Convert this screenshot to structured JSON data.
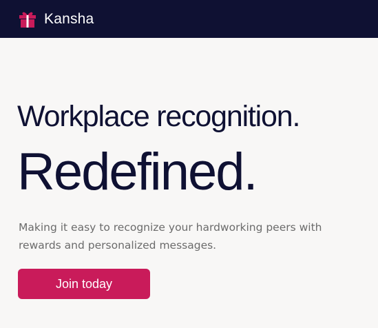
{
  "navbar": {
    "brand_name": "Kansha",
    "logo_icon": "gift-icon",
    "background_color": "#0f1133",
    "logo_color": "#c91b5a"
  },
  "hero": {
    "headline": "Workplace recognition.",
    "subheadline": "Redefined.",
    "description": "Making it easy to recognize your hardworking peers with rewards and personalized messages.",
    "cta_label": "Join today",
    "accent_color": "#c91b5a",
    "text_color": "#0f1133"
  }
}
